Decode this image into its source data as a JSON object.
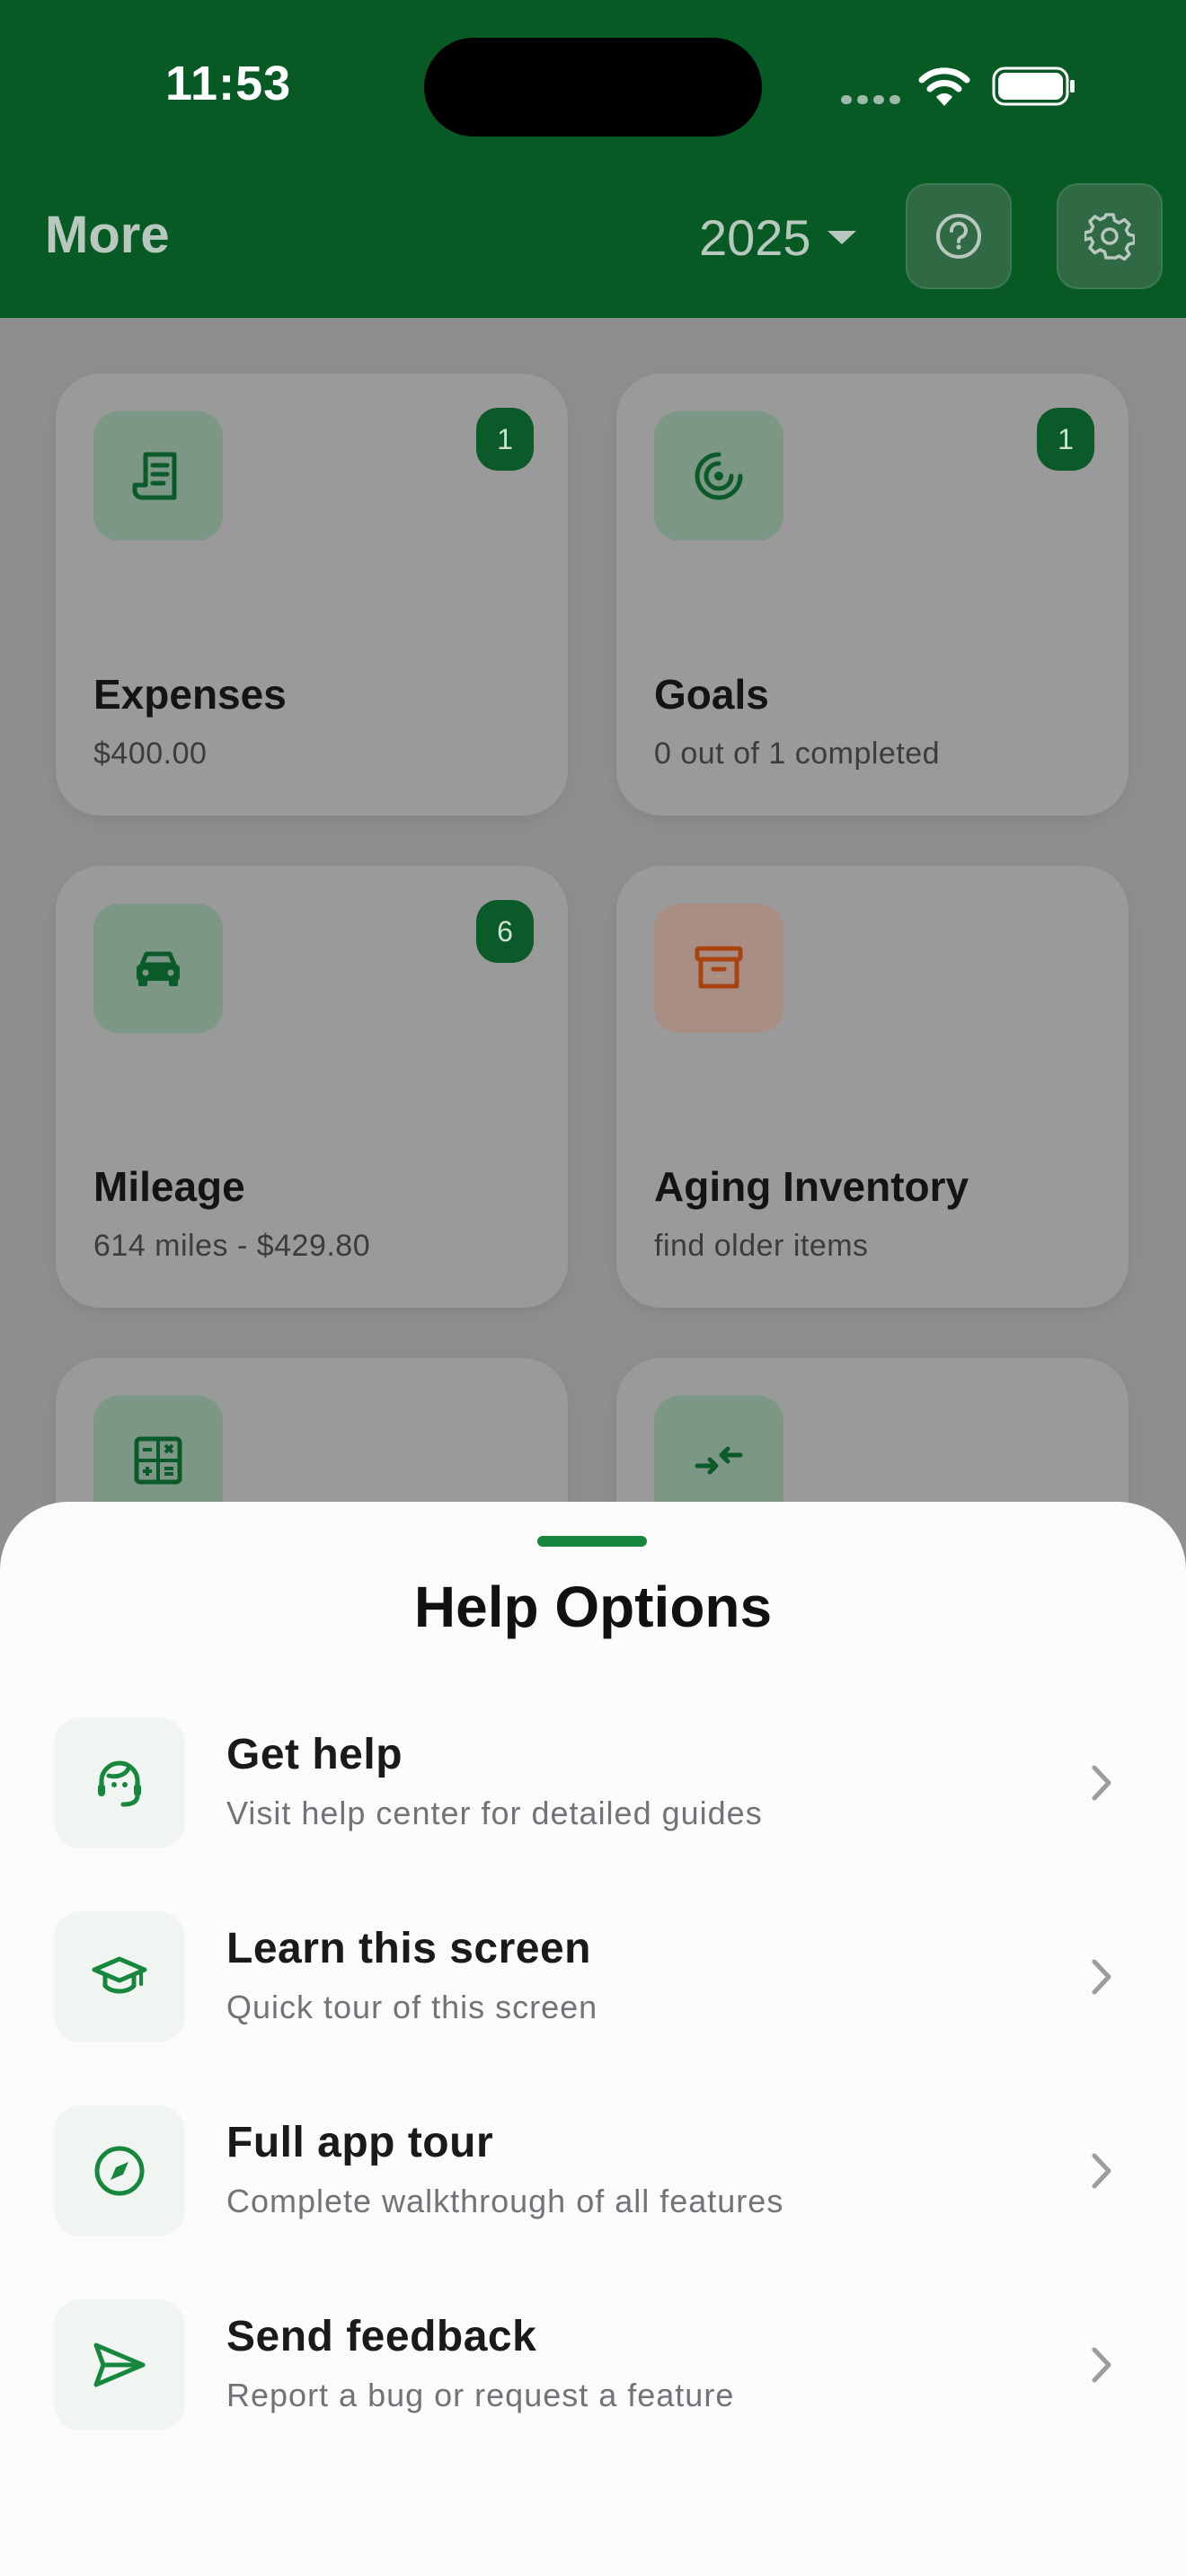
{
  "status_bar": {
    "time": "11:53"
  },
  "header": {
    "title": "More",
    "year": "2025"
  },
  "cards": [
    {
      "title": "Expenses",
      "subtitle": "$400.00",
      "badge": "1",
      "icon": "receipt-icon"
    },
    {
      "title": "Goals",
      "subtitle": "0 out of 1 completed",
      "badge": "1",
      "icon": "target-icon"
    },
    {
      "title": "Mileage",
      "subtitle": "614 miles - $429.80",
      "badge": "6",
      "icon": "car-icon"
    },
    {
      "title": "Aging Inventory",
      "subtitle": "find older items",
      "badge": "",
      "icon": "archive-icon"
    },
    {
      "title": "",
      "subtitle": "",
      "badge": "",
      "icon": "calculator-icon"
    },
    {
      "title": "",
      "subtitle": "",
      "badge": "",
      "icon": "compress-arrows-icon"
    }
  ],
  "help_sheet": {
    "title": "Help Options",
    "options": [
      {
        "title": "Get help",
        "subtitle": "Visit help center for detailed guides",
        "icon": "headset-icon"
      },
      {
        "title": "Learn this screen",
        "subtitle": "Quick tour of this screen",
        "icon": "graduation-cap-icon"
      },
      {
        "title": "Full app tour",
        "subtitle": "Complete walkthrough of all features",
        "icon": "compass-icon"
      },
      {
        "title": "Send feedback",
        "subtitle": "Report a bug or request a feature",
        "icon": "send-icon"
      }
    ]
  },
  "colors": {
    "header_bg": "#075A24",
    "accent": "#16873C",
    "badge": "#0B5A2A",
    "aging_icon": "#C4541E"
  }
}
